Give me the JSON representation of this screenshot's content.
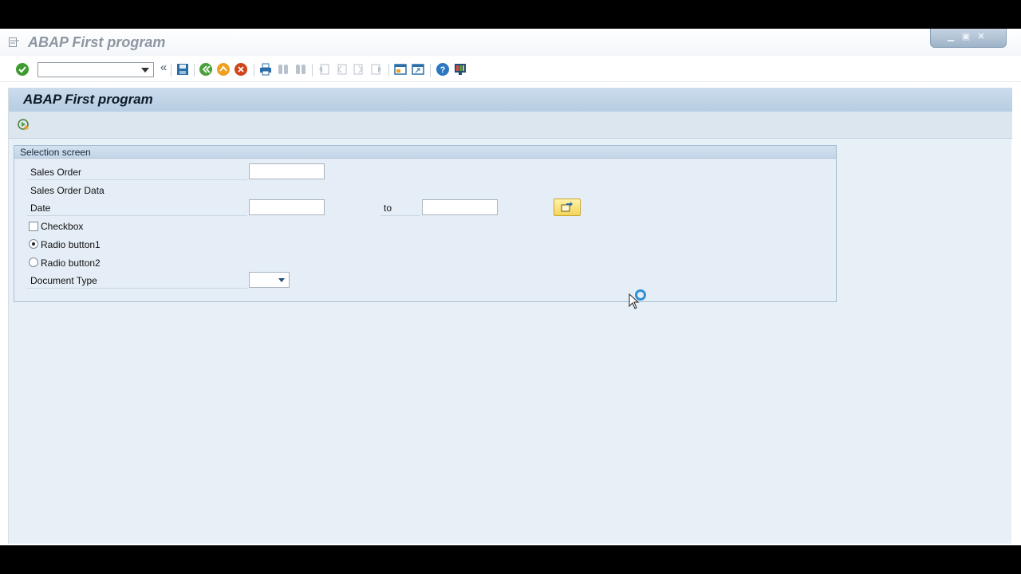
{
  "window": {
    "title": "ABAP First program",
    "controls": {
      "minimize": "▁",
      "maximize": "▣",
      "close": "✕"
    }
  },
  "toolbar": {
    "command_field_value": "",
    "back_symbol": "«",
    "icons": [
      "enter-icon",
      "save-icon",
      "back-icon",
      "exit-icon",
      "cancel-icon",
      "print-icon",
      "find-icon",
      "find-next-icon",
      "first-page-icon",
      "previous-page-icon",
      "next-page-icon",
      "last-page-icon",
      "new-session-icon",
      "shortcut-icon",
      "help-icon",
      "customize-layout-icon"
    ]
  },
  "page": {
    "title": "ABAP First program",
    "app_toolbar_icons": [
      "execute-icon"
    ]
  },
  "selection": {
    "group_title": "Selection screen",
    "sales_order_label": "Sales Order",
    "sales_order_value": "",
    "sales_order_data_label": "Sales Order Data",
    "date_label": "Date",
    "date_from_value": "",
    "to_label": "to",
    "date_to_value": "",
    "checkbox_label": "Checkbox",
    "checkbox_checked": false,
    "radio1_label": "Radio button1",
    "radio1_selected": true,
    "radio2_label": "Radio button2",
    "radio2_selected": false,
    "document_type_label": "Document Type",
    "document_type_value": ""
  },
  "colors": {
    "accent_blue": "#2e8fd8",
    "header_bg": "#b7cde2",
    "main_bg": "#e8f0f7",
    "multi_select_button": "#f5d45a"
  }
}
